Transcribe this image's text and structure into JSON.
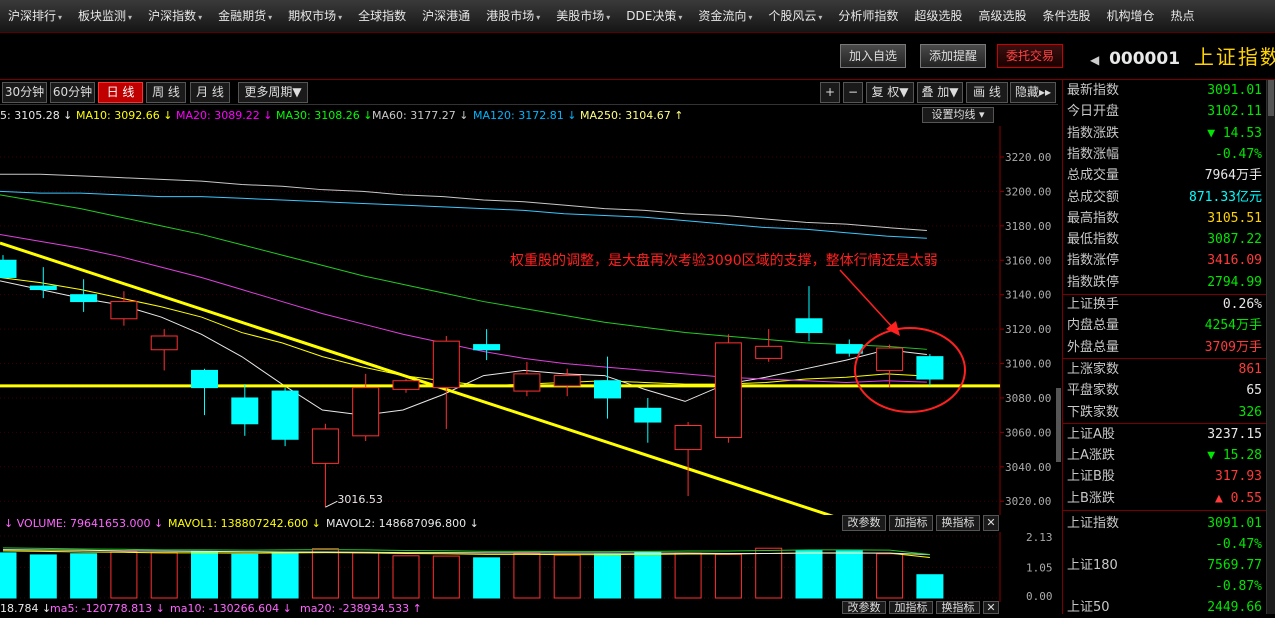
{
  "nav": [
    {
      "label": "沪深排行",
      "arrow": true
    },
    {
      "label": "板块监测",
      "arrow": true
    },
    {
      "label": "沪深指数",
      "arrow": true
    },
    {
      "label": "金融期货",
      "arrow": true
    },
    {
      "label": "期权市场",
      "arrow": true
    },
    {
      "label": "全球指数",
      "arrow": false
    },
    {
      "label": "沪深港通",
      "arrow": false
    },
    {
      "label": "港股市场",
      "arrow": true
    },
    {
      "label": "美股市场",
      "arrow": true
    },
    {
      "label": "DDE决策",
      "arrow": true
    },
    {
      "label": "资金流向",
      "arrow": true
    },
    {
      "label": "个股风云",
      "arrow": true
    },
    {
      "label": "分析师指数",
      "arrow": false
    },
    {
      "label": "超级选股",
      "arrow": false
    },
    {
      "label": "高级选股",
      "arrow": false
    },
    {
      "label": "条件选股",
      "arrow": false
    },
    {
      "label": "机构增仓",
      "arrow": false
    },
    {
      "label": "热点",
      "arrow": false
    }
  ],
  "actions": {
    "add_watch": "加入自选",
    "add_alert": "添加提醒",
    "trade": "委托交易"
  },
  "stock": {
    "code": "000001",
    "name": "上证指数",
    "left_arrow": "◀"
  },
  "toolbar": {
    "periods": [
      "30分钟",
      "60分钟",
      "日 线",
      "周 线",
      "月 线",
      "更多周期▼"
    ],
    "plus": "+",
    "minus": "−",
    "fuquan": "复 权▼",
    "overlay": "叠 加▼",
    "draw": "画 线",
    "hide": "隐藏▸▸"
  },
  "ma_legend": [
    {
      "text": "5: 3105.28 ↓",
      "color": "#e8e8e8"
    },
    {
      "text": "MA10: 3092.66 ↓",
      "color": "#ffff00"
    },
    {
      "text": "MA20: 3089.22 ↓",
      "color": "#ff00ff"
    },
    {
      "text": "MA30: 3108.26 ↓",
      "color": "#00ff00"
    },
    {
      "text": "MA60: 3177.27 ↓",
      "color": "#c8c8c8"
    },
    {
      "text": "MA120: 3172.81 ↓",
      "color": "#00b4ff"
    },
    {
      "text": "MA250: 3104.67 ↑",
      "color": "#ffff80"
    }
  ],
  "set_ma": "设置均线 ▾",
  "price_axis": {
    "ticks": [
      "3220.00",
      "3200.00",
      "3180.00",
      "3160.00",
      "3140.00",
      "3120.00",
      "3100.00",
      "3080.00",
      "3060.00",
      "3040.00",
      "3020.00"
    ]
  },
  "annotation": "权重股的调整，是大盘再次考验3090区域的支撑，整体行情还是太弱",
  "low_label": "3016.53",
  "chart_data": {
    "type": "candlestick",
    "ylim": [
      3012,
      3238
    ],
    "candles": [
      {
        "o": 3160,
        "h": 3163,
        "l": 3150,
        "c": 3150
      },
      {
        "o": 3145,
        "h": 3156,
        "l": 3138,
        "c": 3143
      },
      {
        "o": 3140,
        "h": 3149,
        "l": 3130,
        "c": 3136
      },
      {
        "o": 3126,
        "h": 3142,
        "l": 3122,
        "c": 3136
      },
      {
        "o": 3108,
        "h": 3120,
        "l": 3096,
        "c": 3116
      },
      {
        "o": 3096,
        "h": 3097,
        "l": 3070,
        "c": 3086
      },
      {
        "o": 3080,
        "h": 3088,
        "l": 3058,
        "c": 3065
      },
      {
        "o": 3084,
        "h": 3086,
        "l": 3052,
        "c": 3056
      },
      {
        "o": 3042,
        "h": 3065,
        "l": 3016.53,
        "c": 3062
      },
      {
        "o": 3058,
        "h": 3094,
        "l": 3055,
        "c": 3086
      },
      {
        "o": 3085,
        "h": 3091,
        "l": 3083,
        "c": 3090
      },
      {
        "o": 3086,
        "h": 3116,
        "l": 3062,
        "c": 3113
      },
      {
        "o": 3111,
        "h": 3120,
        "l": 3102,
        "c": 3108
      },
      {
        "o": 3084,
        "h": 3101,
        "l": 3081,
        "c": 3094
      },
      {
        "o": 3087,
        "h": 3097,
        "l": 3081,
        "c": 3093
      },
      {
        "o": 3090,
        "h": 3104,
        "l": 3068,
        "c": 3080
      },
      {
        "o": 3074,
        "h": 3080,
        "l": 3054,
        "c": 3066
      },
      {
        "o": 3050,
        "h": 3066,
        "l": 3023,
        "c": 3064
      },
      {
        "o": 3057,
        "h": 3117,
        "l": 3054,
        "c": 3112
      },
      {
        "o": 3103,
        "h": 3120,
        "l": 3101,
        "c": 3110
      },
      {
        "o": 3126,
        "h": 3145,
        "l": 3113,
        "c": 3118
      },
      {
        "o": 3111,
        "h": 3114,
        "l": 3104,
        "c": 3106
      },
      {
        "o": 3096,
        "h": 3111,
        "l": 3086,
        "c": 3109
      },
      {
        "o": 3104,
        "h": 3105.51,
        "l": 3087.22,
        "c": 3091.01
      }
    ],
    "support_level": 3087,
    "trendline": [
      [
        3170,
        3011
      ]
    ],
    "ma": {
      "ma5": [
        3148,
        3143,
        3138,
        3134,
        3127,
        3117,
        3104,
        3088,
        3073,
        3070,
        3073,
        3082,
        3093,
        3096,
        3094,
        3093,
        3085,
        3078,
        3088,
        3092,
        3097,
        3102,
        3108,
        3105.28
      ],
      "ma10": [
        3150,
        3147,
        3143,
        3138,
        3133,
        3127,
        3118,
        3112,
        3104,
        3098,
        3093,
        3090,
        3087,
        3088,
        3089,
        3090,
        3089,
        3088,
        3088,
        3089,
        3091,
        3092,
        3094,
        3092.66
      ],
      "ma20": [
        3175,
        3171,
        3167,
        3162,
        3156,
        3150,
        3143,
        3136,
        3129,
        3123,
        3117,
        3112,
        3107,
        3103,
        3100,
        3098,
        3096,
        3094,
        3092,
        3091,
        3090,
        3089,
        3090,
        3089.22
      ],
      "ma30": [
        3198,
        3194,
        3190,
        3185,
        3180,
        3175,
        3169,
        3163,
        3157,
        3151,
        3146,
        3141,
        3136,
        3132,
        3128,
        3124,
        3121,
        3118,
        3116,
        3114,
        3112,
        3111,
        3110,
        3108.26
      ],
      "ma60": [
        3210,
        3210,
        3209,
        3208,
        3207,
        3206,
        3204,
        3203,
        3201,
        3200,
        3198,
        3197,
        3195,
        3194,
        3192,
        3190,
        3189,
        3187,
        3186,
        3184,
        3182,
        3181,
        3179,
        3177.27
      ],
      "ma120": [
        3200,
        3199,
        3199,
        3198,
        3197,
        3197,
        3196,
        3195,
        3194,
        3193,
        3192,
        3191,
        3190,
        3189,
        3187,
        3186,
        3185,
        3183,
        3181,
        3179,
        3178,
        3176,
        3174,
        3172.81
      ]
    },
    "volume": {
      "values": [
        1.55,
        1.48,
        1.52,
        1.58,
        1.56,
        1.6,
        1.5,
        1.56,
        1.7,
        1.55,
        1.45,
        1.44,
        1.38,
        1.53,
        1.47,
        1.5,
        1.57,
        1.54,
        1.5,
        1.71,
        1.63,
        1.62,
        1.52,
        0.8
      ],
      "ylim": [
        0,
        2.13
      ],
      "ticks": [
        "2.13",
        "1.05",
        "0.00"
      ],
      "mavol1": [
        1.62,
        1.6,
        1.58,
        1.57,
        1.55,
        1.55,
        1.54,
        1.55,
        1.56,
        1.55,
        1.53,
        1.52,
        1.5,
        1.5,
        1.49,
        1.49,
        1.5,
        1.51,
        1.51,
        1.53,
        1.55,
        1.55,
        1.54,
        1.39
      ],
      "mavol2": [
        1.66,
        1.65,
        1.64,
        1.62,
        1.61,
        1.6,
        1.59,
        1.58,
        1.58,
        1.57,
        1.56,
        1.56,
        1.55,
        1.55,
        1.54,
        1.54,
        1.54,
        1.54,
        1.53,
        1.53,
        1.54,
        1.54,
        1.54,
        1.49
      ]
    }
  },
  "vol_legend": [
    {
      "text": "↓ VOLUME: 79641653.000 ↓",
      "color": "#ff66ff"
    },
    {
      "text": "MAVOL1: 138807242.600 ↓",
      "color": "#ffff00"
    },
    {
      "text": "MAVOL2: 148687096.800 ↓",
      "color": "#e8e8e8"
    }
  ],
  "vol_buttons": {
    "params": "改参数",
    "change": "加指标",
    "switch": "换指标",
    "close": "✕"
  },
  "bottom_legend": [
    {
      "text": "18.784 ↓",
      "color": "#e8e8e8"
    },
    {
      "text": "ma5: -120778.813 ↓",
      "color": "#ff66ff"
    },
    {
      "text": "ma10: -130266.604 ↓",
      "color": "#ff66ff"
    },
    {
      "text": "ma20: -238934.533 ↑",
      "color": "#ff66ff"
    }
  ],
  "quote_panel": [
    {
      "label": "最新指数",
      "value": "3091.01",
      "color": "green"
    },
    {
      "label": "今日开盘",
      "value": "3102.11",
      "color": "green"
    },
    {
      "label": "指数涨跌",
      "value": "▼ 14.53",
      "color": "green"
    },
    {
      "label": "指数涨幅",
      "value": "-0.47%",
      "color": "green"
    },
    {
      "label": "总成交量",
      "value": "7964万手",
      "color": "white"
    },
    {
      "label": "总成交额",
      "value": "871.33亿元",
      "color": "cyan"
    },
    {
      "label": "最高指数",
      "value": "3105.51",
      "color": "yellow"
    },
    {
      "label": "最低指数",
      "value": "3087.22",
      "color": "green"
    },
    {
      "label": "指数涨停",
      "value": "3416.09",
      "color": "red"
    },
    {
      "label": "指数跌停",
      "value": "2794.99",
      "color": "green"
    },
    {
      "label": "上证换手",
      "value": "0.26%",
      "color": "white"
    },
    {
      "label": "内盘总量",
      "value": "4254万手",
      "color": "green"
    },
    {
      "label": "外盘总量",
      "value": "3709万手",
      "color": "red"
    },
    {
      "label": "上涨家数",
      "value": "861",
      "color": "red"
    },
    {
      "label": "平盘家数",
      "value": "65",
      "color": "white"
    },
    {
      "label": "下跌家数",
      "value": "326",
      "color": "green"
    },
    {
      "label": "上证A股",
      "value": "3237.15",
      "color": "white"
    },
    {
      "label": "上A涨跌",
      "value": "▼ 15.28",
      "color": "green"
    },
    {
      "label": "上证B股",
      "value": "317.93",
      "color": "red"
    },
    {
      "label": "上B涨跌",
      "value": "▲ 0.55",
      "color": "red"
    }
  ],
  "index_list": [
    {
      "name": "上证指数",
      "value": "3091.01",
      "pct": "-0.47%"
    },
    {
      "name": "上证180",
      "value": "7569.77",
      "pct": "-0.87%"
    },
    {
      "name": "上证50",
      "value": "2449.66",
      "pct": ""
    }
  ]
}
